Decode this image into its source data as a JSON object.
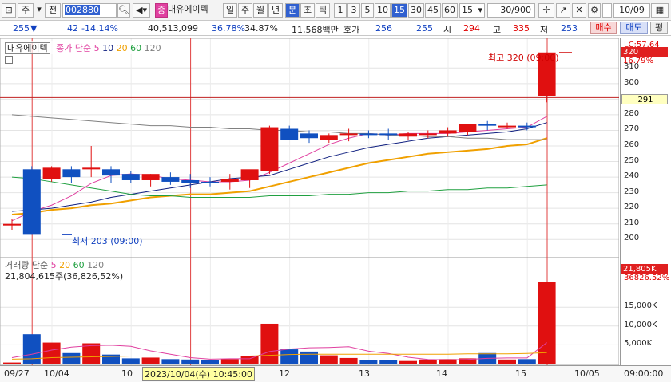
{
  "toolbar": {
    "btn_ju": "주",
    "btn_jeon": "전",
    "code": "002880",
    "stock_name": "대유에이텍",
    "stock_mark": "증",
    "periods": [
      "일",
      "주",
      "월",
      "년",
      "분",
      "초",
      "틱"
    ],
    "minutes": [
      "1",
      "3",
      "5",
      "10",
      "15",
      "30",
      "45",
      "60"
    ],
    "selected_minute": "15",
    "count": "30/900",
    "checkbox_value": "10/09"
  },
  "info": {
    "price": "255",
    "arrow": "▼",
    "change": "42",
    "change_pct": "-14.14%",
    "volume": "40,513,099",
    "rate1": "36.78%",
    "rate2": "34.87%",
    "amount": "11,568백만",
    "hoga_label": "호가",
    "hoga_value": "256",
    "hoga_value2": "255",
    "open_label": "시",
    "open_value": "294",
    "high_label": "고",
    "high_value": "335",
    "low_label": "저",
    "low_value": "253",
    "buy_label": "매수",
    "sell_label": "매도",
    "eval_label": "평"
  },
  "price_panel": {
    "legend_name": "대유에이텍",
    "legend_ma": "종가 단순",
    "ma_periods": [
      "5",
      "10",
      "20",
      "60",
      "120"
    ],
    "ma_colors": [
      "#e040a0",
      "#102080",
      "#f0a000",
      "#20a040",
      "#808080"
    ],
    "high_annot": "최고 320 (09:00)",
    "low_annot": "최저 203 (09:00)",
    "lc_label": "LC:57.64",
    "last_box": "320",
    "last_pct": "16.79%",
    "cross_box": "291",
    "y_ticks": [
      "310",
      "300",
      "290",
      "280",
      "270",
      "260",
      "250",
      "240",
      "230",
      "220",
      "210",
      "200"
    ]
  },
  "volume_panel": {
    "legend": "거래량 단순",
    "ma_periods": [
      "5",
      "20",
      "60",
      "120"
    ],
    "value_text": "21,804,615주(36,826,52%)",
    "vol_box": "21,805K",
    "vol_pct": "36826.52%",
    "y_ticks": [
      "15,000K",
      "10,000K",
      "5,000K"
    ]
  },
  "date_axis": {
    "labels": [
      "09/27",
      "10/04",
      "10",
      "12",
      "13",
      "14",
      "15",
      "10/05"
    ],
    "cursor": "2023/10/04(수) 10:45:00",
    "time": "09:00:00"
  },
  "chart_data": {
    "type": "candlestick",
    "candles": [
      {
        "o": 210,
        "h": 213,
        "l": 206,
        "c": 210
      },
      {
        "o": 245,
        "h": 247,
        "l": 203,
        "c": 203
      },
      {
        "o": 239,
        "h": 247,
        "l": 237,
        "c": 246
      },
      {
        "o": 245,
        "h": 247,
        "l": 236,
        "c": 240
      },
      {
        "o": 246,
        "h": 260,
        "l": 240,
        "c": 246
      },
      {
        "o": 245,
        "h": 247,
        "l": 236,
        "c": 241
      },
      {
        "o": 242,
        "h": 244,
        "l": 236,
        "c": 238
      },
      {
        "o": 238,
        "h": 242,
        "l": 234,
        "c": 242
      },
      {
        "o": 240,
        "h": 243,
        "l": 235,
        "c": 237
      },
      {
        "o": 238,
        "h": 242,
        "l": 233,
        "c": 236
      },
      {
        "o": 237,
        "h": 240,
        "l": 234,
        "c": 236
      },
      {
        "o": 237,
        "h": 242,
        "l": 232,
        "c": 239
      },
      {
        "o": 238,
        "h": 244,
        "l": 233,
        "c": 245
      },
      {
        "o": 244,
        "h": 273,
        "l": 242,
        "c": 272
      },
      {
        "o": 271,
        "h": 273,
        "l": 264,
        "c": 264
      },
      {
        "o": 268,
        "h": 270,
        "l": 262,
        "c": 265
      },
      {
        "o": 264,
        "h": 268,
        "l": 262,
        "c": 267
      },
      {
        "o": 267,
        "h": 271,
        "l": 263,
        "c": 268
      },
      {
        "o": 268,
        "h": 270,
        "l": 265,
        "c": 267
      },
      {
        "o": 268,
        "h": 271,
        "l": 264,
        "c": 267
      },
      {
        "o": 266,
        "h": 269,
        "l": 264,
        "c": 268
      },
      {
        "o": 267,
        "h": 270,
        "l": 265,
        "c": 268
      },
      {
        "o": 268,
        "h": 272,
        "l": 266,
        "c": 270
      },
      {
        "o": 269,
        "h": 274,
        "l": 267,
        "c": 274
      },
      {
        "o": 274,
        "h": 276,
        "l": 270,
        "c": 273
      },
      {
        "o": 273,
        "h": 275,
        "l": 271,
        "c": 273
      },
      {
        "o": 273,
        "h": 275,
        "l": 270,
        "c": 272
      },
      {
        "o": 292,
        "h": 320,
        "l": 288,
        "c": 320
      }
    ],
    "ma": {
      "5": [
        212,
        218,
        222,
        228,
        236,
        241,
        242,
        241,
        239,
        238,
        237,
        237,
        238,
        243,
        249,
        255,
        261,
        265,
        268,
        267,
        268,
        268,
        268,
        269,
        270,
        271,
        272,
        279
      ],
      "10": [
        218,
        219,
        220,
        222,
        224,
        227,
        229,
        231,
        233,
        235,
        237,
        239,
        240,
        241,
        245,
        249,
        253,
        256,
        259,
        261,
        263,
        265,
        266,
        267,
        268,
        269,
        271,
        275
      ],
      "20": [
        216,
        217,
        219,
        220,
        222,
        223,
        225,
        227,
        228,
        229,
        229,
        230,
        231,
        234,
        237,
        240,
        243,
        246,
        249,
        251,
        253,
        255,
        256,
        257,
        258,
        260,
        261,
        265
      ],
      "60": [
        240,
        239,
        237,
        235,
        233,
        231,
        229,
        228,
        228,
        227,
        227,
        227,
        227,
        228,
        228,
        228,
        229,
        229,
        230,
        230,
        231,
        231,
        232,
        232,
        233,
        233,
        234,
        235
      ],
      "120": [
        280,
        279,
        278,
        277,
        276,
        275,
        274,
        273,
        273,
        272,
        272,
        271,
        271,
        270,
        270,
        269,
        269,
        268,
        268,
        267,
        267,
        266,
        266,
        265,
        265,
        264,
        264,
        264
      ]
    },
    "volumes": [
      0.3,
      7.8,
      5.6,
      2.8,
      5.4,
      2.4,
      1.4,
      1.6,
      1.2,
      1.1,
      1.0,
      1.2,
      2.0,
      10.6,
      3.8,
      3.2,
      2.2,
      1.5,
      1.0,
      0.9,
      0.7,
      1.1,
      1.2,
      1.4,
      2.8,
      1.1,
      1.2,
      21.8
    ],
    "vol_ma5": [
      1.6,
      2.5,
      3.6,
      4.4,
      4.8,
      4.9,
      4.6,
      3.4,
      2.5,
      1.6,
      1.2,
      1.3,
      1.3,
      3.2,
      3.9,
      4.2,
      4.3,
      4.5,
      3.3,
      2.7,
      1.7,
      1.1,
      1.0,
      1.1,
      1.4,
      1.5,
      1.5,
      5.6
    ],
    "vol_ma20": [
      1.2,
      1.3,
      1.6,
      1.7,
      1.8,
      1.9,
      2.0,
      2.0,
      2.0,
      2.0,
      2.0,
      2.0,
      2.0,
      2.2,
      2.4,
      2.5,
      2.5,
      2.5,
      2.5,
      2.5,
      2.5,
      2.5,
      2.5,
      2.6,
      2.6,
      2.6,
      2.7,
      2.9
    ],
    "ylim": [
      195,
      325
    ],
    "vol_ylim": [
      0,
      25
    ]
  }
}
